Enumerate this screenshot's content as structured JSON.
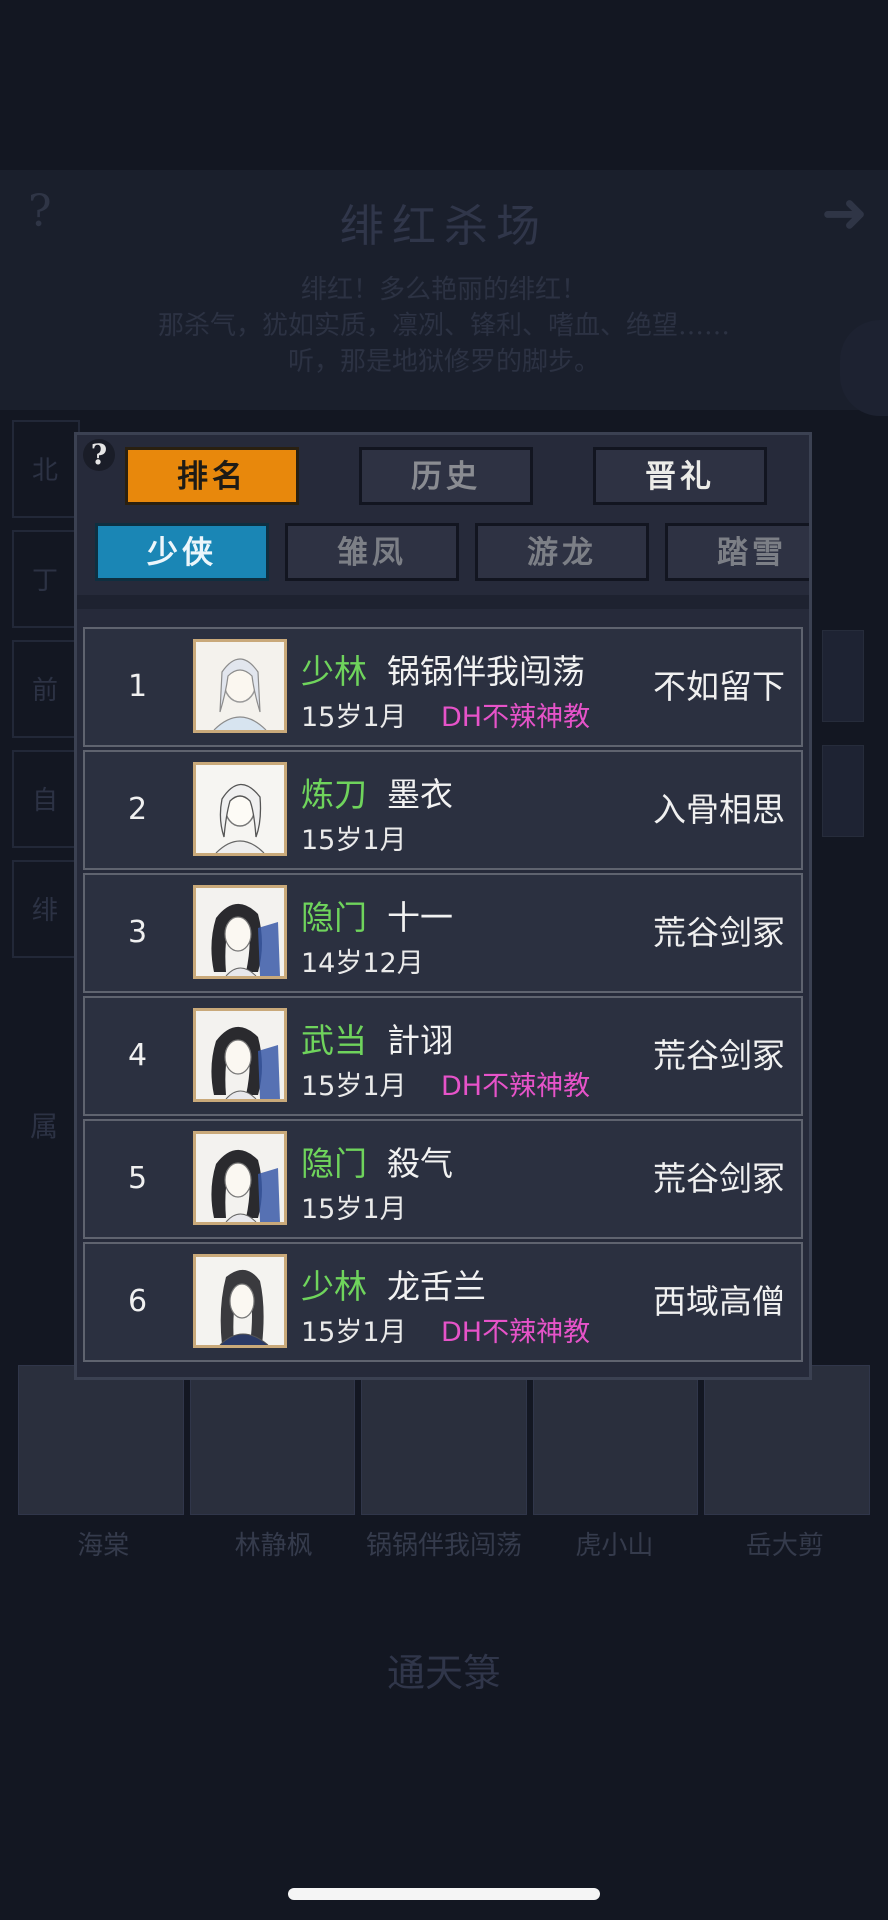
{
  "background": {
    "title": "绯红杀场",
    "desc_line1": "绯红！多么艳丽的绯红！",
    "desc_line2": "那杀气，犹如实质，凛冽、锋利、嗜血、绝望……",
    "desc_line3": "听，那是地狱修罗的脚步。",
    "side_labels": [
      "北",
      "丁",
      "前",
      "自",
      "绯"
    ],
    "attr_label": "属",
    "portrait_names": [
      "海棠",
      "林静枫",
      "锅锅伴我闯荡",
      "虎小山",
      "岳大剪"
    ],
    "bottom_button": "通天箓"
  },
  "dialog": {
    "help_label": "?",
    "main_tabs": [
      {
        "label": "排名",
        "active": true
      },
      {
        "label": "历史",
        "active": false
      },
      {
        "label": "晋礼",
        "active": false
      }
    ],
    "sub_tabs": [
      {
        "label": "少侠",
        "active": true
      },
      {
        "label": "雏凤",
        "active": false
      },
      {
        "label": "游龙",
        "active": false
      },
      {
        "label": "踏雪",
        "active": false
      }
    ],
    "rows": [
      {
        "rank": "1",
        "sect": "少林",
        "name": "锅锅伴我闯荡",
        "age": "15岁1月",
        "guild": "DH不辣神教",
        "title": "不如留下"
      },
      {
        "rank": "2",
        "sect": "炼刀",
        "name": "墨衣",
        "age": "15岁1月",
        "guild": "",
        "title": "入骨相思"
      },
      {
        "rank": "3",
        "sect": "隐门",
        "name": "十一",
        "age": "14岁12月",
        "guild": "",
        "title": "荒谷剑冢"
      },
      {
        "rank": "4",
        "sect": "武当",
        "name": "計诩",
        "age": "15岁1月",
        "guild": "DH不辣神教",
        "title": "荒谷剑冢"
      },
      {
        "rank": "5",
        "sect": "隐门",
        "name": "殺气",
        "age": "15岁1月",
        "guild": "",
        "title": "荒谷剑冢"
      },
      {
        "rank": "6",
        "sect": "少林",
        "name": "龙舌兰",
        "age": "15岁1月",
        "guild": "DH不辣神教",
        "title": "西域高僧"
      }
    ]
  },
  "colors": {
    "tab_active": "#e8880c",
    "subtab_active": "#1a86b5",
    "sect_green": "#6fd45c",
    "guild_pink": "#e653c9"
  }
}
